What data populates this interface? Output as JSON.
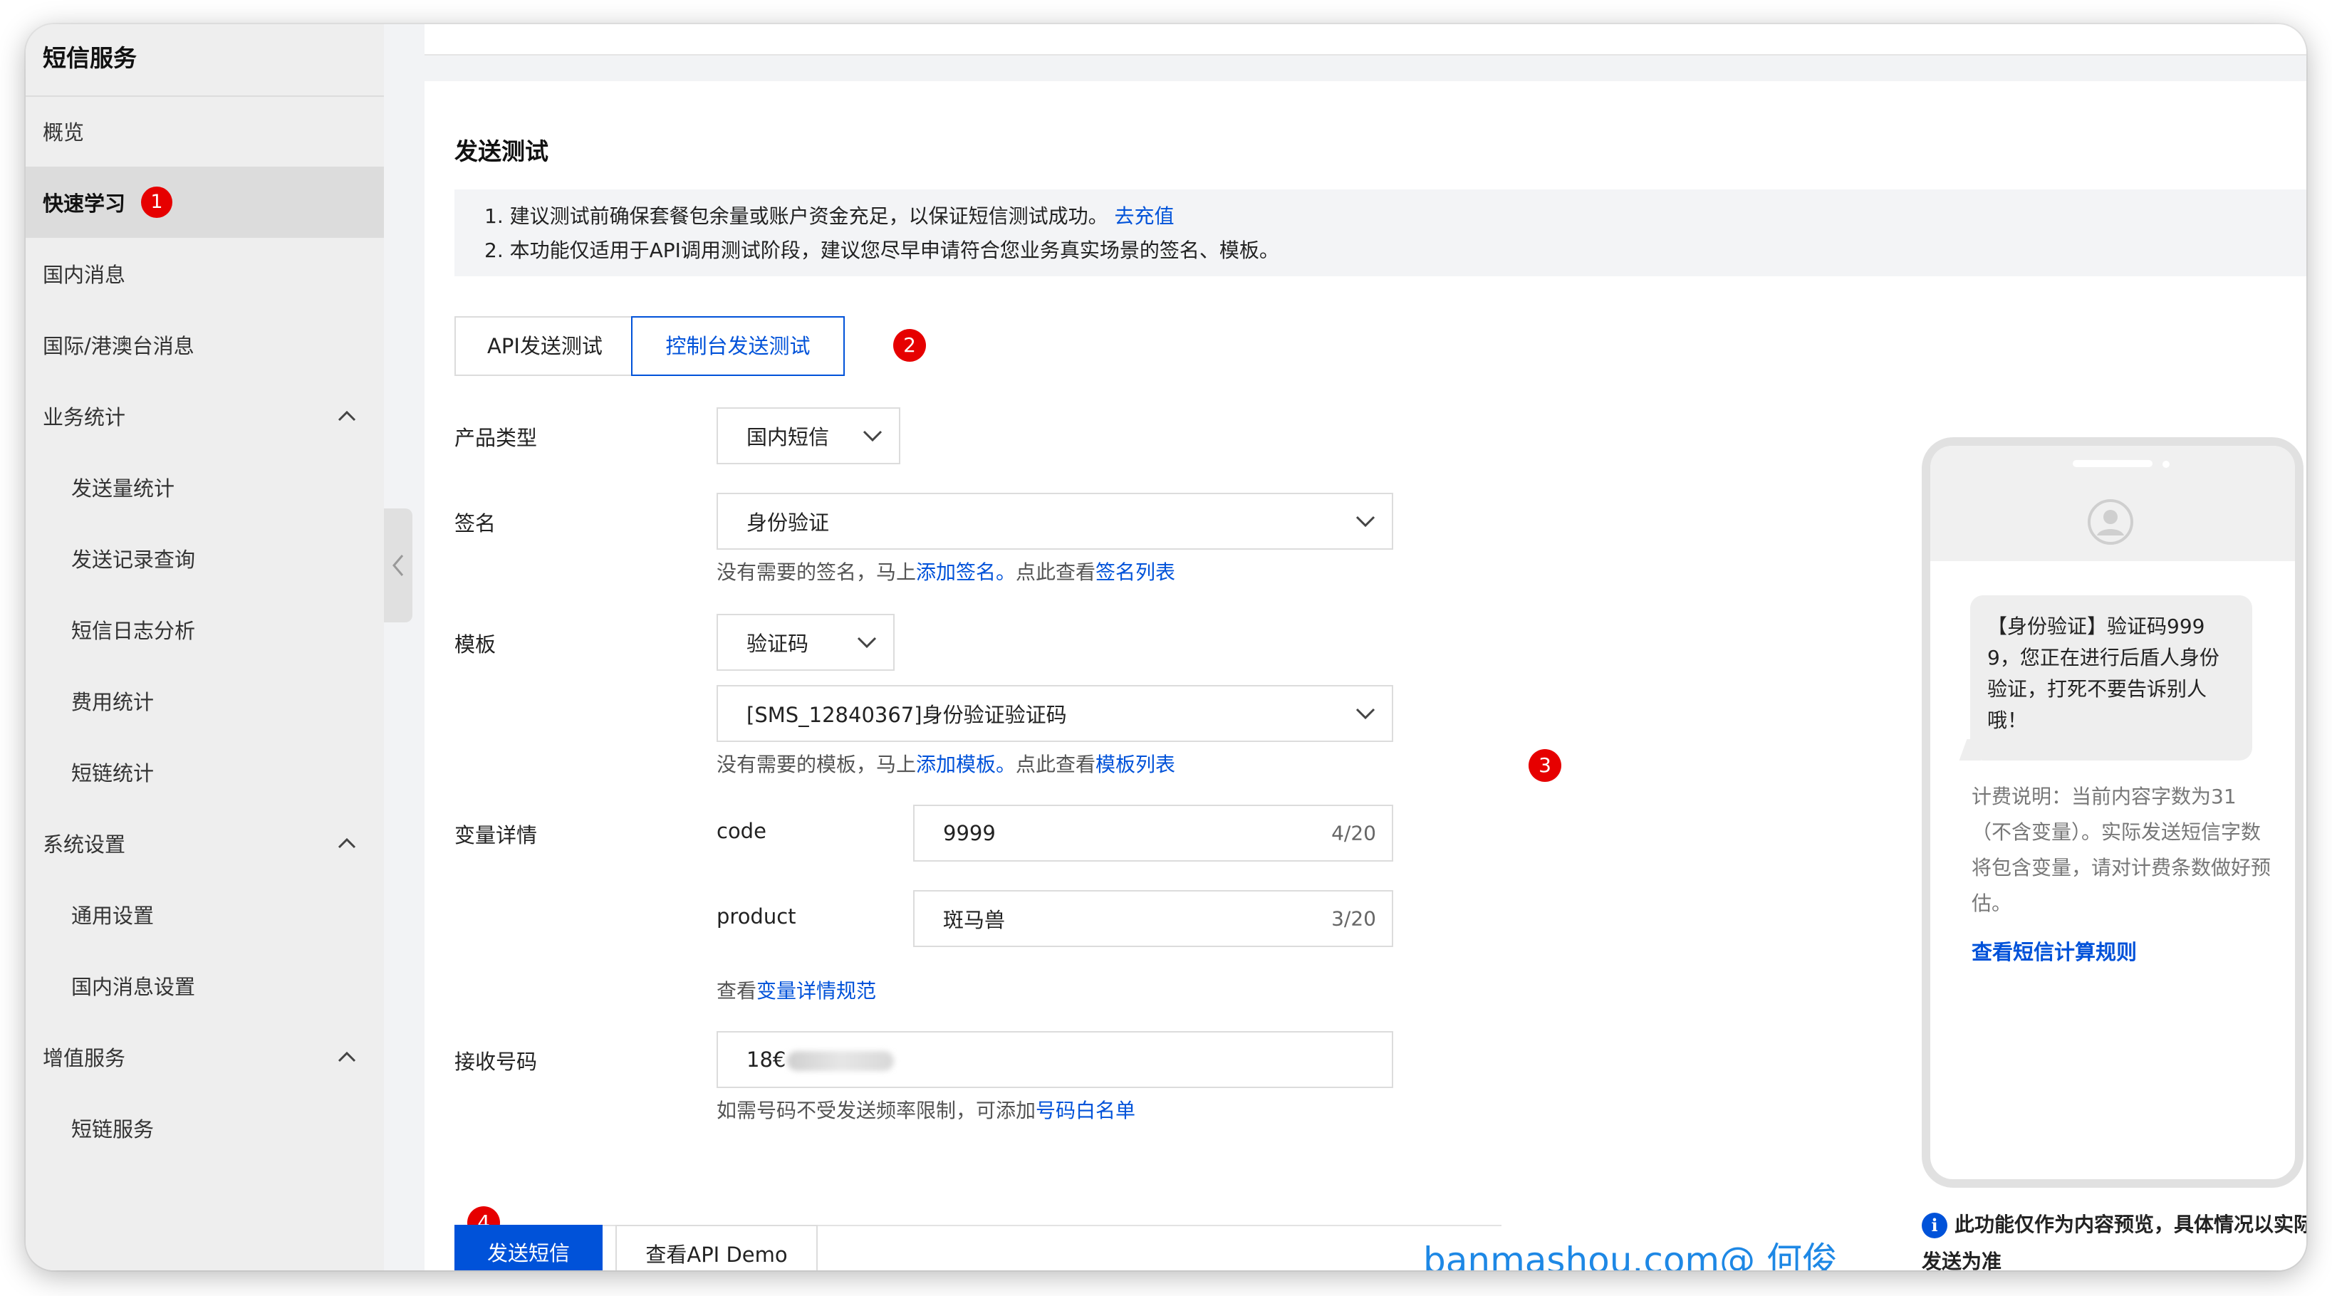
{
  "sidebar": {
    "title": "短信服务",
    "items": [
      {
        "label": "概览"
      },
      {
        "label": "快速学习",
        "badge": "1"
      },
      {
        "label": "国内消息"
      },
      {
        "label": "国际/港澳台消息"
      },
      {
        "label": "业务统计"
      },
      {
        "label": "发送量统计"
      },
      {
        "label": "发送记录查询"
      },
      {
        "label": "短信日志分析"
      },
      {
        "label": "费用统计"
      },
      {
        "label": "短链统计"
      },
      {
        "label": "系统设置"
      },
      {
        "label": "通用设置"
      },
      {
        "label": "国内消息设置"
      },
      {
        "label": "增值服务"
      },
      {
        "label": "短链服务"
      }
    ]
  },
  "section": {
    "title": "发送测试",
    "notice_line1": "1. 建议测试前确保套餐包余量或账户资金充足，以保证短信测试成功。",
    "notice_link": "去充值",
    "notice_line2": "2. 本功能仅适用于API调用测试阶段，建议您尽早申请符合您业务真实场景的签名、模板。"
  },
  "tabs": {
    "api": "API发送测试",
    "console": "控制台发送测试",
    "badge": "2"
  },
  "form": {
    "product_label": "产品类型",
    "product_value": "国内短信",
    "sign_label": "签名",
    "sign_value": "身份验证",
    "sign_hint_prefix": "没有需要的签名，马上",
    "sign_hint_add": "添加签名。",
    "sign_hint_mid": "点此查看",
    "sign_hint_list": "签名列表",
    "template_label": "模板",
    "template_type": "验证码",
    "template_value": "[SMS_12840367]身份验证验证码",
    "template_hint_prefix": "没有需要的模板，马上",
    "template_hint_add": "添加模板。",
    "template_hint_mid": "点此查看",
    "template_hint_list": "模板列表",
    "marker3": "3",
    "vars_label": "变量详情",
    "var1_name": "code",
    "var1_value": "9999",
    "var1_count": "4/20",
    "var2_name": "product",
    "var2_value": "斑马兽",
    "var2_count": "3/20",
    "vars_hint_prefix": "查看",
    "vars_hint_link": "变量详情规范",
    "phone_label": "接收号码",
    "phone_value": "18€",
    "phone_hint_prefix": "如需号码不受发送频率限制，可添加",
    "phone_hint_link": "号码白名单"
  },
  "actions": {
    "badge": "4",
    "send": "发送短信",
    "demo": "查看API Demo"
  },
  "watermark": "banmashou.com@ 何俊",
  "preview": {
    "message": "【身份验证】验证码9999，您正在进行后盾人身份验证，打死不要告诉别人哦！",
    "billing": "计费说明：当前内容字数为31（不含变量）。实际发送短信字数将包含变量，请对计费条数做好预估。",
    "billing_link": "查看短信计算规则",
    "note": "此功能仅作为内容预览，具体情况以实际发送为准"
  },
  "colors": {
    "accent": "#0052d9",
    "badge": "#e60000",
    "watermark": "#1e88e5"
  }
}
